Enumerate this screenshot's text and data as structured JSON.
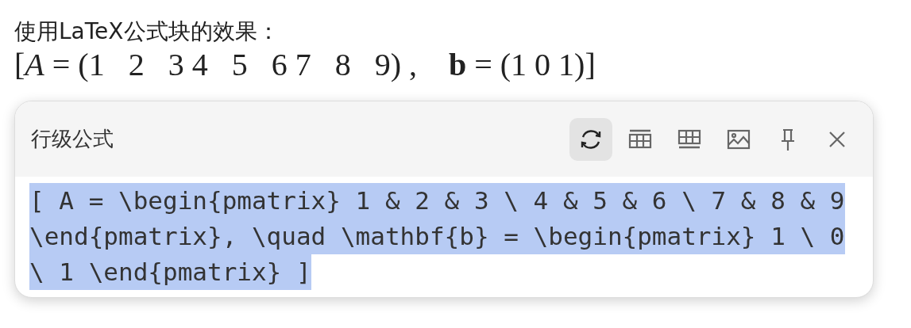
{
  "heading": "使用LaTeX公式块的效果：",
  "formula": "[*A* = (1   2   3 4   5   6 7   8   9) ,    **b** = (1 0 1)]",
  "popup": {
    "title": "行级公式",
    "toolbar": [
      {
        "kind": "refresh",
        "selected": true
      },
      {
        "kind": "table-above",
        "selected": false
      },
      {
        "kind": "table-below",
        "selected": false
      },
      {
        "kind": "image",
        "selected": false
      },
      {
        "kind": "pin",
        "selected": false
      },
      {
        "kind": "close",
        "selected": false
      }
    ],
    "code": {
      "lines": [
        "[ A = \\begin{pmatrix} 1 & 2 & 3 \\ 4 & 5 & 6 \\ 7 & 8 & 9",
        "\\end{pmatrix}, \\quad \\mathbf{b} = \\begin{pmatrix} 1 \\ 0",
        "\\ 1 \\end{pmatrix} ]"
      ],
      "selected": true
    }
  }
}
